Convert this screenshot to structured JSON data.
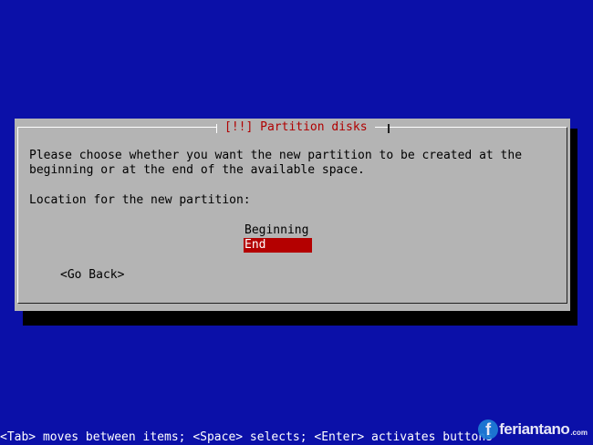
{
  "dialog": {
    "title": "[!!] Partition disks",
    "message_line1": "Please choose whether you want the new partition to be created at the",
    "message_line2": "beginning or at the end of the available space.",
    "prompt": "Location for the new partition:",
    "options": [
      {
        "label": "Beginning",
        "selected": false
      },
      {
        "label": "End",
        "selected": true
      }
    ],
    "go_back_label": "<Go Back>"
  },
  "status_bar": {
    "text": "<Tab> moves between items; <Space> selects; <Enter> activates buttons"
  },
  "watermark": {
    "text": "feriantano",
    "suffix": ".com"
  },
  "colors": {
    "background": "#0b10a8",
    "dialog": "#b4b4b4",
    "title": "#b00000",
    "selection": "#b40000"
  }
}
